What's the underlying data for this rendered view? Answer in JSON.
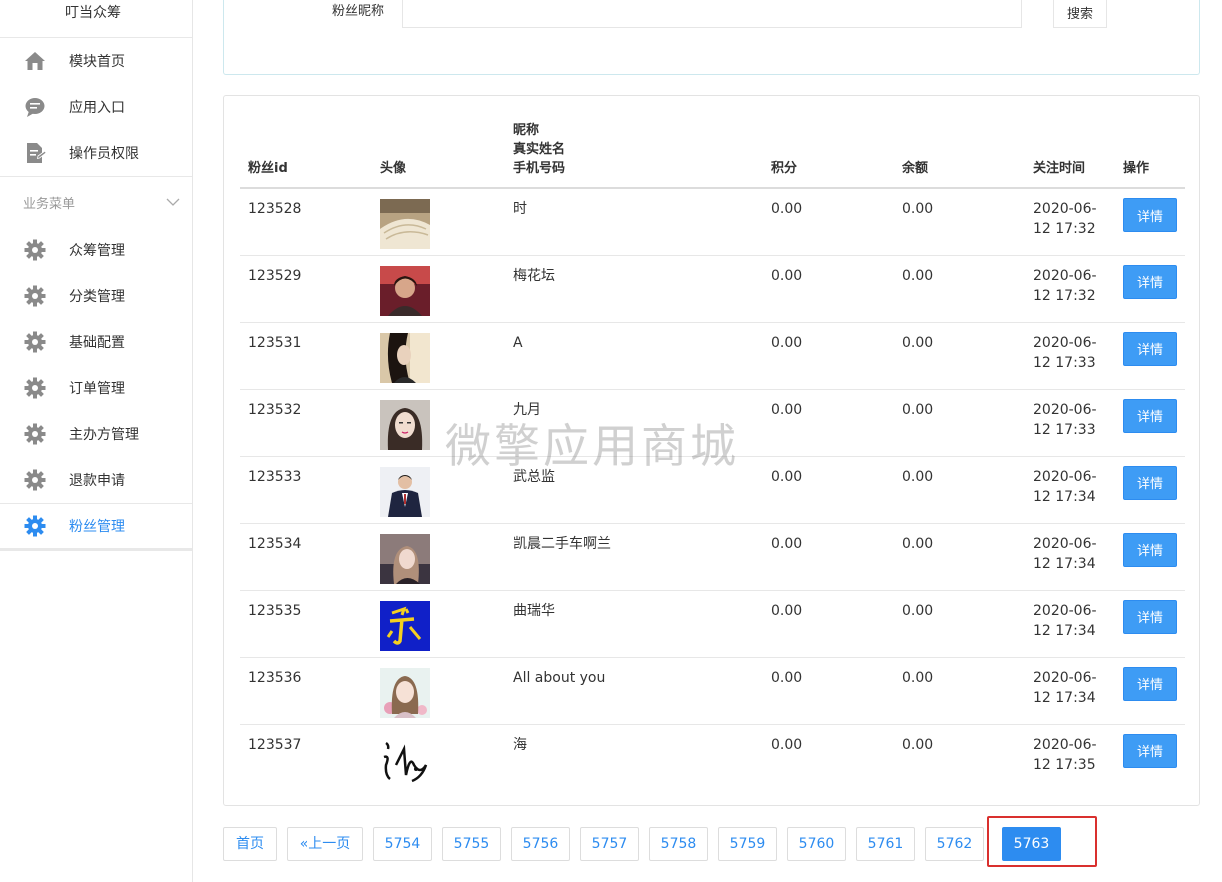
{
  "sidebar": {
    "title": "叮当众筹",
    "top_items": [
      {
        "label": "模块首页",
        "icon": "home-icon"
      },
      {
        "label": "应用入口",
        "icon": "chat-bubble-icon"
      },
      {
        "label": "操作员权限",
        "icon": "document-edit-icon"
      }
    ],
    "section_label": "业务菜单",
    "biz_items": [
      {
        "label": "众筹管理",
        "icon": "gear-icon"
      },
      {
        "label": "分类管理",
        "icon": "gear-icon"
      },
      {
        "label": "基础配置",
        "icon": "gear-icon"
      },
      {
        "label": "订单管理",
        "icon": "gear-icon"
      },
      {
        "label": "主办方管理",
        "icon": "gear-icon"
      },
      {
        "label": "退款申请",
        "icon": "gear-icon"
      },
      {
        "label": "粉丝管理",
        "icon": "gear-icon",
        "active": true
      }
    ]
  },
  "search": {
    "label": "粉丝昵称",
    "value": "",
    "button_label": "搜索"
  },
  "table": {
    "headers": {
      "id": "粉丝id",
      "avatar": "头像",
      "name_line1": "昵称",
      "name_line2": "真实姓名",
      "name_line3": "手机号码",
      "points": "积分",
      "balance": "余额",
      "follow_time": "关注时间",
      "ops": "操作"
    },
    "detail_label": "详情",
    "rows": [
      {
        "id": "123528",
        "nickname": "时",
        "points": "0.00",
        "balance": "0.00",
        "time_date": "2020-06-",
        "time_rest": "12 17:32",
        "avatar": "book-photo"
      },
      {
        "id": "123529",
        "nickname": "梅花坛",
        "points": "0.00",
        "balance": "0.00",
        "time_date": "2020-06-",
        "time_rest": "12 17:32",
        "avatar": "woman-portrait"
      },
      {
        "id": "123531",
        "nickname": "A",
        "points": "0.00",
        "balance": "0.00",
        "time_date": "2020-06-",
        "time_rest": "12 17:33",
        "avatar": "girl-portrait"
      },
      {
        "id": "123532",
        "nickname": "九月",
        "points": "0.00",
        "balance": "0.00",
        "time_date": "2020-06-",
        "time_rest": "12 17:33",
        "avatar": "woman-selfie"
      },
      {
        "id": "123533",
        "nickname": "武总监",
        "points": "0.00",
        "balance": "0.00",
        "time_date": "2020-06-",
        "time_rest": "12 17:34",
        "avatar": "man-suit"
      },
      {
        "id": "123534",
        "nickname": "凯晨二手车啊兰",
        "points": "0.00",
        "balance": "0.00",
        "time_date": "2020-06-",
        "time_rest": "12 17:34",
        "avatar": "woman-car"
      },
      {
        "id": "123535",
        "nickname": "曲瑞华",
        "points": "0.00",
        "balance": "0.00",
        "time_date": "2020-06-",
        "time_rest": "12 17:34",
        "avatar": "blue-yellow-logo"
      },
      {
        "id": "123536",
        "nickname": "All about you",
        "points": "0.00",
        "balance": "0.00",
        "time_date": "2020-06-",
        "time_rest": "12 17:34",
        "avatar": "woman-flowers"
      },
      {
        "id": "123537",
        "nickname": "海",
        "points": "0.00",
        "balance": "0.00",
        "time_date": "2020-06-",
        "time_rest": "12 17:35",
        "avatar": "calligraphy"
      }
    ]
  },
  "watermark": "微擎应用商城",
  "pagination": {
    "first": "首页",
    "prev": "«上一页",
    "pages": [
      "5754",
      "5755",
      "5756",
      "5757",
      "5758",
      "5759",
      "5760",
      "5761",
      "5762",
      "5763"
    ],
    "current": "5763"
  },
  "colors": {
    "accent": "#2d8cf0",
    "button": "#3e9cf5",
    "highlight": "#d9302e"
  }
}
